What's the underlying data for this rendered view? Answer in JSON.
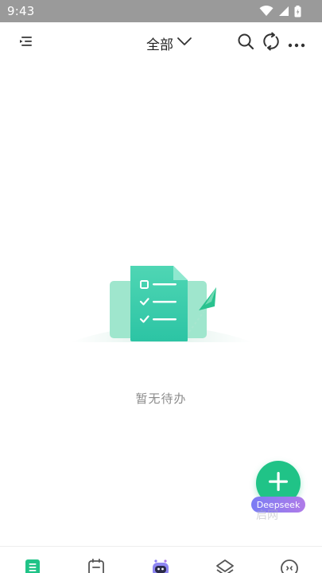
{
  "status_bar": {
    "time": "9:43",
    "icons": [
      "wifi-icon",
      "signal-icon",
      "battery-icon"
    ]
  },
  "header": {
    "filter_label": "全部",
    "left_icon": "menu-icon",
    "right_icons": [
      "search-icon",
      "sync-icon",
      "more-icon"
    ]
  },
  "empty_state": {
    "message": "暂无待办"
  },
  "fab": {
    "icon": "plus-icon",
    "badge_label": "Deepseek",
    "watermark": "启网"
  },
  "bottom_nav": {
    "items": [
      "todo-list-icon",
      "calendar-icon",
      "ai-robot-icon",
      "layers-icon",
      "profile-face-icon"
    ],
    "active_index": 0
  },
  "colors": {
    "accent": "#20c387",
    "status_bar": "#9a9a9a",
    "empty_text": "#8c8c8c",
    "badge_start": "#7a7cf4",
    "badge_end": "#b07be8"
  }
}
